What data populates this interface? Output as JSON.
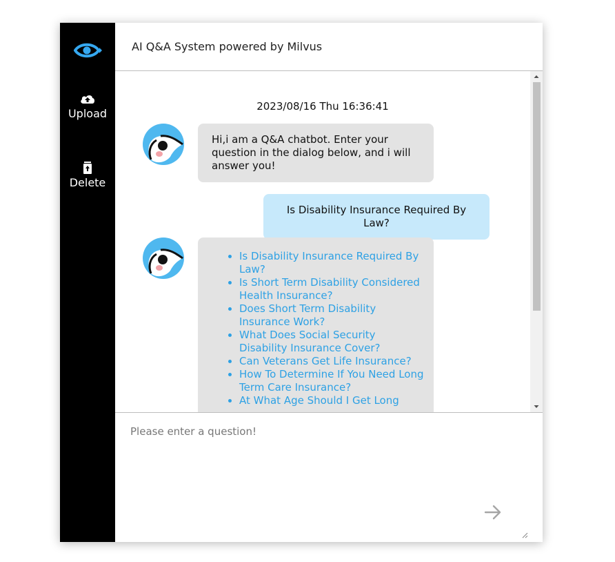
{
  "sidebar": {
    "logo_icon": "eye-icon",
    "upload": {
      "label": "Upload",
      "icon": "cloud-upload-icon"
    },
    "delete": {
      "label": "Delete",
      "icon": "trash-icon"
    }
  },
  "header": {
    "title": "AI Q&A System powered by Milvus"
  },
  "chat": {
    "timestamp": "2023/08/16 Thu 16:36:41",
    "messages": [
      {
        "role": "bot",
        "text": "Hi,i am a Q&A chatbot. Enter your question in the dialog below, and i will answer you!"
      },
      {
        "role": "user",
        "text": "Is Disability Insurance Required By Law?"
      },
      {
        "role": "bot",
        "answers": [
          "Is Disability Insurance Required By Law?",
          "Is Short Term Disability Considered Health Insurance?",
          "Does Short Term Disability Insurance Work?",
          "What Does Social Security Disability Insurance Cover?",
          "Can Veterans Get Life Insurance?",
          "How To Determine If You Need Long Term Care Insurance?",
          "At What Age Should I Get Long"
        ]
      }
    ]
  },
  "composer": {
    "placeholder": "Please enter a question!",
    "value": "",
    "send_icon": "arrow-right-icon"
  },
  "colors": {
    "sidebar_bg": "#000000",
    "accent": "#2ea1e4",
    "bot_bubble": "#e3e3e3",
    "user_bubble": "#c7e9fb"
  }
}
